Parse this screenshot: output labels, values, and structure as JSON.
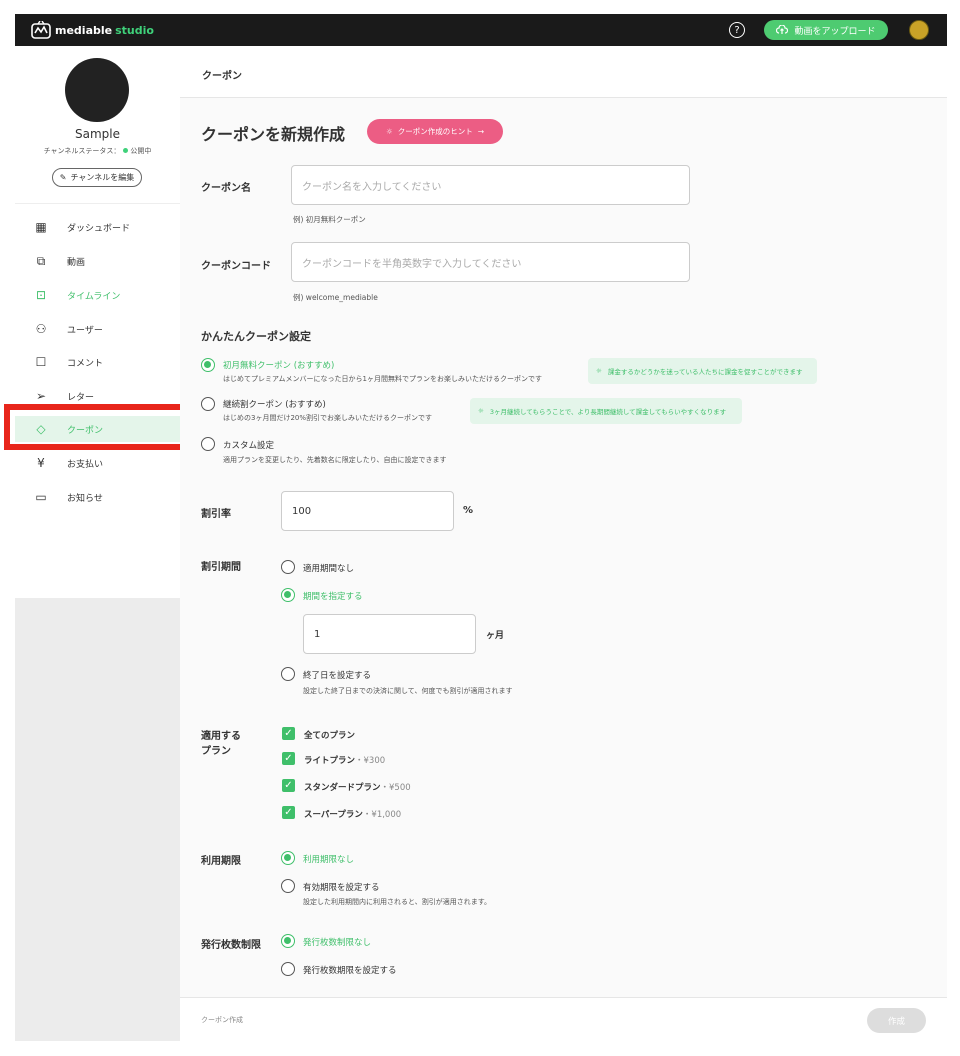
{
  "app": {
    "logo_text_1": "mediable",
    "logo_text_2": "studio",
    "help_icon": "?",
    "upload_label": "動画をアップロード"
  },
  "channel": {
    "name": "Sample",
    "status_prefix": "チャンネルステータス：",
    "status_value": "公開中",
    "edit_label": "チャンネルを編集"
  },
  "sidebar": {
    "items": [
      {
        "label": "ダッシュボード",
        "icon": "grid-icon"
      },
      {
        "label": "動画",
        "icon": "video-icon"
      },
      {
        "label": "タイムライン",
        "icon": "timeline-icon"
      },
      {
        "label": "ユーザー",
        "icon": "user-icon"
      },
      {
        "label": "コメント",
        "icon": "comment-icon"
      },
      {
        "label": "レター",
        "icon": "letter-icon"
      },
      {
        "label": "クーポン",
        "icon": "coupon-icon"
      },
      {
        "label": "お支払い",
        "icon": "payment-icon"
      },
      {
        "label": "お知らせ",
        "icon": "notice-icon"
      }
    ]
  },
  "breadcrumb": "クーポン",
  "page": {
    "title": "クーポンを新規作成",
    "hint_button": "クーポン作成のヒント"
  },
  "form": {
    "coupon_name": {
      "label": "クーポン名",
      "placeholder": "クーポン名を入力してください",
      "example": "例) 初月無料クーポン"
    },
    "coupon_code": {
      "label": "クーポンコード",
      "placeholder": "クーポンコードを半角英数字で入力してください",
      "example": "例) welcome_mediable"
    },
    "easy_settings": {
      "heading": "かんたんクーポン設定",
      "options": [
        {
          "title": "初月無料クーポン (おすすめ)",
          "desc": "はじめてプレミアムメンバーになった日から1ヶ月間無料でプランをお楽しみいただけるクーポンです",
          "tip": "課金するかどうかを迷っている人たちに課金を促すことができます",
          "selected": true
        },
        {
          "title": "継続割クーポン (おすすめ)",
          "desc": "はじめの3ヶ月間だけ20%割引でお楽しみいただけるクーポンです",
          "tip": "3ヶ月継続してもらうことで、より長期間継続して課金してもらいやすくなります",
          "selected": false
        },
        {
          "title": "カスタム設定",
          "desc": "適用プランを変更したり、先着数名に限定したり、自由に設定できます",
          "tip": "",
          "selected": false
        }
      ]
    },
    "discount_rate": {
      "label": "割引率",
      "value": "100",
      "unit": "%"
    },
    "discount_period": {
      "label": "割引期間",
      "opt_none": "適用期間なし",
      "opt_specify": "期間を指定する",
      "months_value": "1",
      "months_unit": "ヶ月",
      "opt_end_date": "終了日を設定する",
      "end_date_desc": "設定した終了日までの決済に関して、何度でも割引が適用されます"
    },
    "plans": {
      "label_line1": "適用する",
      "label_line2": "プラン",
      "items": [
        {
          "name": "全てのプラン",
          "price": ""
        },
        {
          "name": "ライトプラン",
          "price": "・¥300"
        },
        {
          "name": "スタンダードプラン",
          "price": "・¥500"
        },
        {
          "name": "スーパープラン",
          "price": "・¥1,000"
        }
      ]
    },
    "usage_period": {
      "label": "利用期限",
      "opt_none": "利用期限なし",
      "opt_set": "有効期限を設定する",
      "set_desc": "設定した利用期間内に利用されると、割引が適用されます。"
    },
    "issue_limit": {
      "label": "発行枚数制限",
      "opt_none": "発行枚数制限なし",
      "opt_set": "発行枚数期限を設定する"
    }
  },
  "footer": {
    "label": "クーポン作成",
    "create_button": "作成"
  },
  "colors": {
    "accent": "#3fbf6a",
    "pink": "#ec5d84",
    "highlight": "#e8261b"
  }
}
